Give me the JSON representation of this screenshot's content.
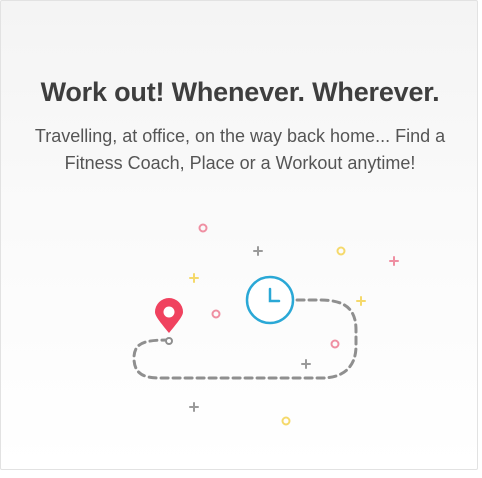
{
  "onboarding": {
    "headline": "Work out! Whenever. Wherever.",
    "subtext": "Travelling, at office, on the way back home... Find a Fitness Coach, Place or a Workout anytime!"
  },
  "illustration": {
    "icons": [
      "location-pin-icon",
      "clock-icon",
      "dashed-route-path"
    ],
    "colors": {
      "pin": "#f0425f",
      "clock": "#2aa8d6",
      "path": "#8f8f8f",
      "pink_dot": "#ef8fa2",
      "yellow_dot": "#f5d96b",
      "gray_plus": "#9a9a9a"
    }
  }
}
